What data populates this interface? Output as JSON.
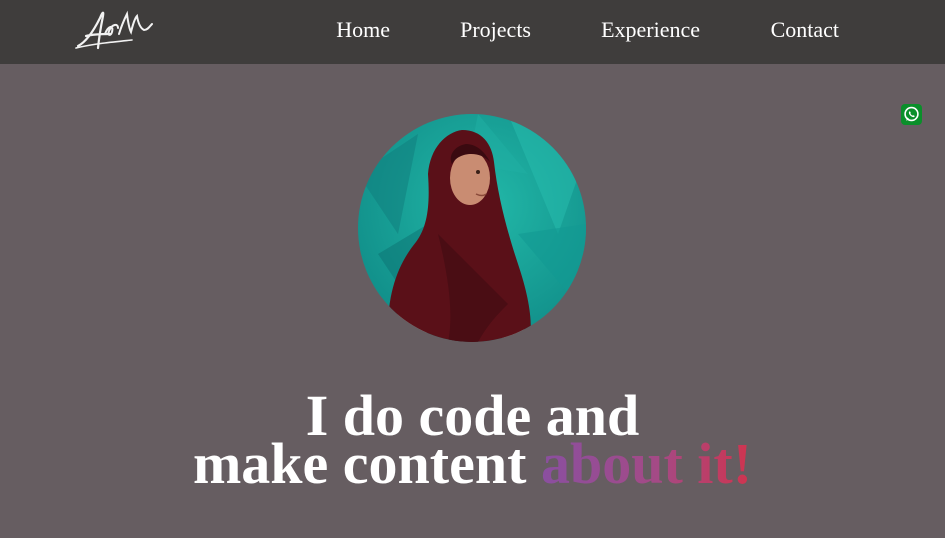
{
  "header": {
    "logo_icon": "signature-logo",
    "nav": [
      {
        "label": "Home"
      },
      {
        "label": "Projects"
      },
      {
        "label": "Experience"
      },
      {
        "label": "Contact"
      }
    ]
  },
  "floating": {
    "whatsapp_icon": "whatsapp-icon",
    "color": "#0a8f2a"
  },
  "hero": {
    "avatar_icon": "profile-photo",
    "line1": "I do code and",
    "line2_plain": "make content",
    "line2_accent": "about it!"
  },
  "colors": {
    "page_bg": "#665d61",
    "navbar_bg": "#3f3d3c",
    "text": "#ffffff",
    "accent_start": "#8a4fa0",
    "accent_end": "#d0344e",
    "avatar_bg": "#1aa89c"
  }
}
